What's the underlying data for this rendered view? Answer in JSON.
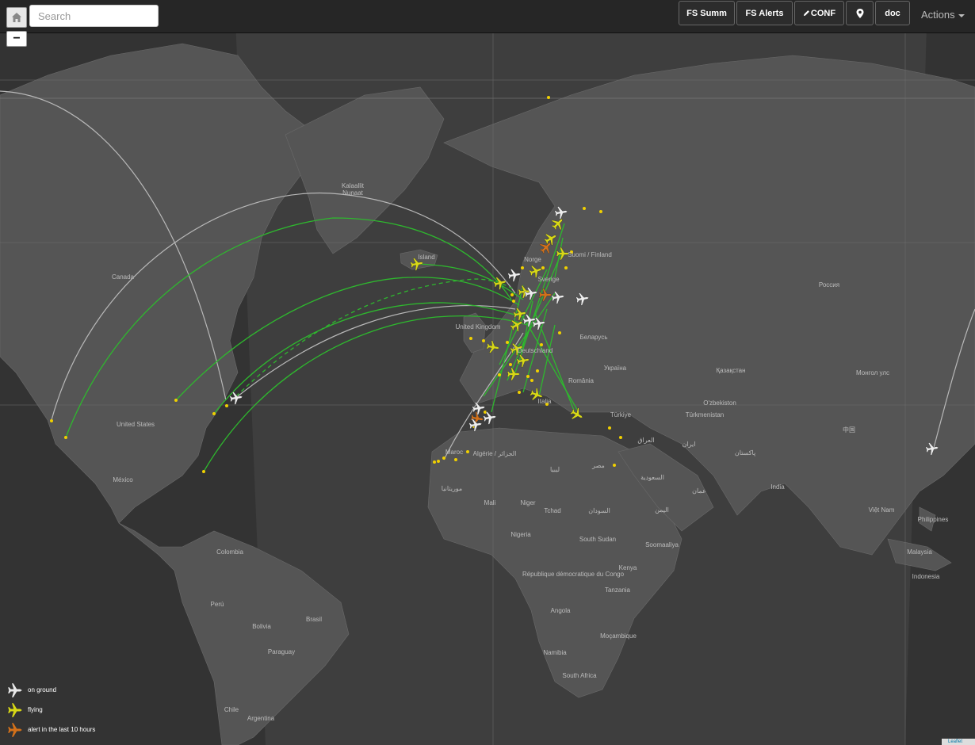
{
  "toolbar": {
    "search_placeholder": "Search",
    "buttons": [
      "FS Summ",
      "FS Alerts",
      "CONF",
      "doc"
    ],
    "actions_label": "Actions",
    "zoom_out_label": "−"
  },
  "legend": [
    {
      "label": "on ground",
      "status": "ground",
      "color": "#e8e8e8"
    },
    {
      "label": "flying",
      "status": "flying",
      "color": "#d8d816"
    },
    {
      "label": "alert in the last 10 hours",
      "status": "alert",
      "color": "#d2701a"
    }
  ],
  "map_labels": [
    {
      "text": "Kalaallit"
    },
    {
      "text": "Nunaat"
    },
    {
      "text": "Canada"
    },
    {
      "text": "United States"
    },
    {
      "text": "México"
    },
    {
      "text": "Colombia"
    },
    {
      "text": "Perú"
    },
    {
      "text": "Brasil"
    },
    {
      "text": "Bolivia"
    },
    {
      "text": "Paraguay"
    },
    {
      "text": "Chile"
    },
    {
      "text": "Argentina"
    },
    {
      "text": "Island"
    },
    {
      "text": "Norge"
    },
    {
      "text": "Sverige"
    },
    {
      "text": "Suomi / Finland"
    },
    {
      "text": "United Kingdom"
    },
    {
      "text": "Deutschland"
    },
    {
      "text": "Italia"
    },
    {
      "text": "Беларусь"
    },
    {
      "text": "Україна"
    },
    {
      "text": "România"
    },
    {
      "text": "Türkiye"
    },
    {
      "text": "Россия"
    },
    {
      "text": "Қазақстан"
    },
    {
      "text": "Монгол улс"
    },
    {
      "text": "O'zbekiston"
    },
    {
      "text": "Türkmenistan"
    },
    {
      "text": "中国"
    },
    {
      "text": "India"
    },
    {
      "text": "Việt Nam"
    },
    {
      "text": "Philippines"
    },
    {
      "text": "Malaysia"
    },
    {
      "text": "Indonesia"
    },
    {
      "text": "Maroc"
    },
    {
      "text": "Algérie / الجزائر"
    },
    {
      "text": "ليبيا"
    },
    {
      "text": "مصر"
    },
    {
      "text": "العراق"
    },
    {
      "text": "ایران"
    },
    {
      "text": "السعودية"
    },
    {
      "text": "پاکستان"
    },
    {
      "text": "Mali"
    },
    {
      "text": "Niger"
    },
    {
      "text": "Tchad"
    },
    {
      "text": "السودان"
    },
    {
      "text": "Nigeria"
    },
    {
      "text": "South Sudan"
    },
    {
      "text": "Soomaaliya"
    },
    {
      "text": "Kenya"
    },
    {
      "text": "République démocratique du Congo"
    },
    {
      "text": "Tanzania"
    },
    {
      "text": "Angola"
    },
    {
      "text": "Moçambique"
    },
    {
      "text": "Namibia"
    },
    {
      "text": "South Africa"
    },
    {
      "text": "اليمن"
    },
    {
      "text": "عمان"
    },
    {
      "text": "موريتانيا"
    }
  ],
  "colors": {
    "flight_line": "#2eb82e",
    "ground_track": "#b0b0b0",
    "airport_dot": "#f0d000"
  },
  "attribution": "Leaflet"
}
